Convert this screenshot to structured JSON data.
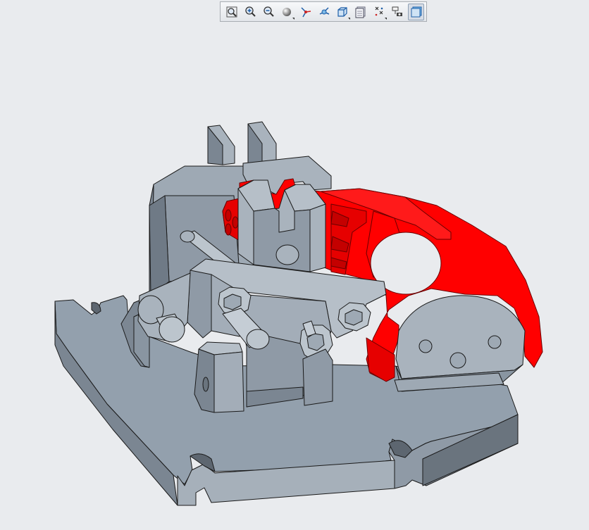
{
  "toolbar": {
    "buttons": [
      {
        "icon": "refit-icon",
        "active": false,
        "flyout": false
      },
      {
        "icon": "zoom-in-icon",
        "active": false,
        "flyout": false
      },
      {
        "icon": "zoom-out-icon",
        "active": false,
        "flyout": false
      },
      {
        "icon": "shading-icon",
        "active": false,
        "flyout": true
      },
      {
        "icon": "datum-axes-icon",
        "active": false,
        "flyout": false
      },
      {
        "icon": "spin-center-icon",
        "active": false,
        "flyout": false
      },
      {
        "icon": "saved-views-icon",
        "active": false,
        "flyout": true
      },
      {
        "icon": "layers-icon",
        "active": false,
        "flyout": false
      },
      {
        "icon": "datum-display-icon",
        "active": false,
        "flyout": true
      },
      {
        "icon": "annotations-icon",
        "active": false,
        "flyout": false
      },
      {
        "icon": "display-style-icon",
        "active": true,
        "flyout": false
      }
    ]
  },
  "colors": {
    "background": "#e9ebee",
    "part_gray": "#8f99a5",
    "part_highlight": "#ff0000",
    "edge": "#1a1a1a"
  },
  "model": {
    "selected_part": "red-bracket-highlight"
  }
}
